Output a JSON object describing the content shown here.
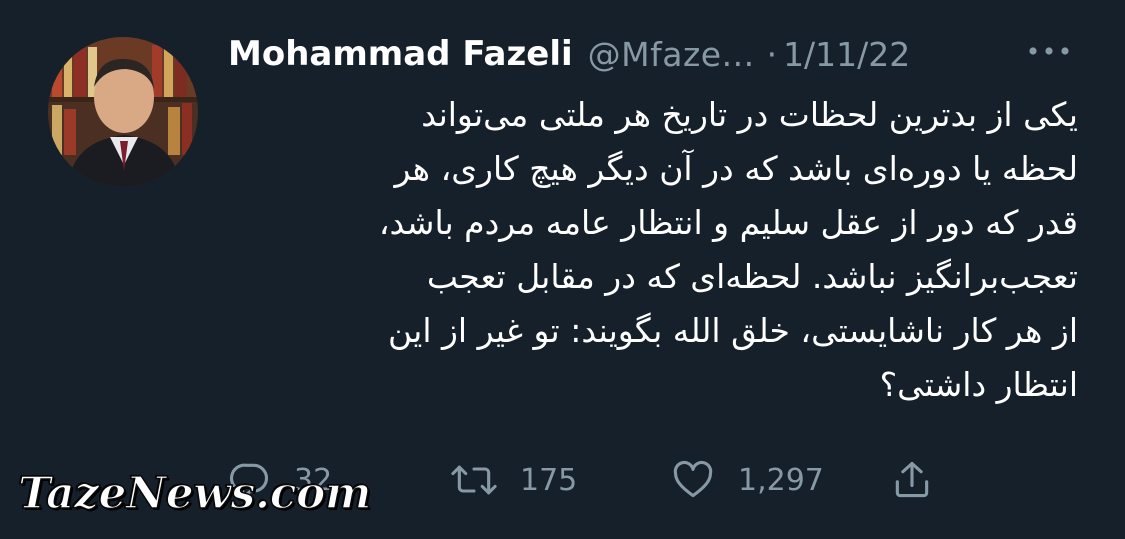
{
  "tweet": {
    "author_name": "Mohammad Fazeli",
    "handle": "@Mfaze...",
    "separator": "·",
    "date": "1/11/22",
    "text": "یکی از بدترین لحظات در تاریخ هر ملتی می‌تواند\nلحظه یا دوره‌ای باشد که در آن دیگر هیچ کاری، هر\nقدر که دور از عقل سلیم و انتظار عامه مردم باشد،\nتعجب‌برانگیز نباشد. لحظه‌ای که در مقابل تعجب\nاز هر کار ناشایستی، خلق الله بگویند: تو غیر از این\nانتظار داشتی؟"
  },
  "actions": {
    "reply_count": "32",
    "retweet_count": "175",
    "like_count": "1,297"
  },
  "icons": {
    "more": "more-horizontal-icon",
    "reply": "reply-icon",
    "retweet": "retweet-icon",
    "like": "heart-icon",
    "share": "share-icon"
  },
  "watermark": {
    "text": "TazeNews.com"
  },
  "colors": {
    "background": "#15202b",
    "primary_text": "#ffffff",
    "secondary_text": "#8899a6"
  }
}
